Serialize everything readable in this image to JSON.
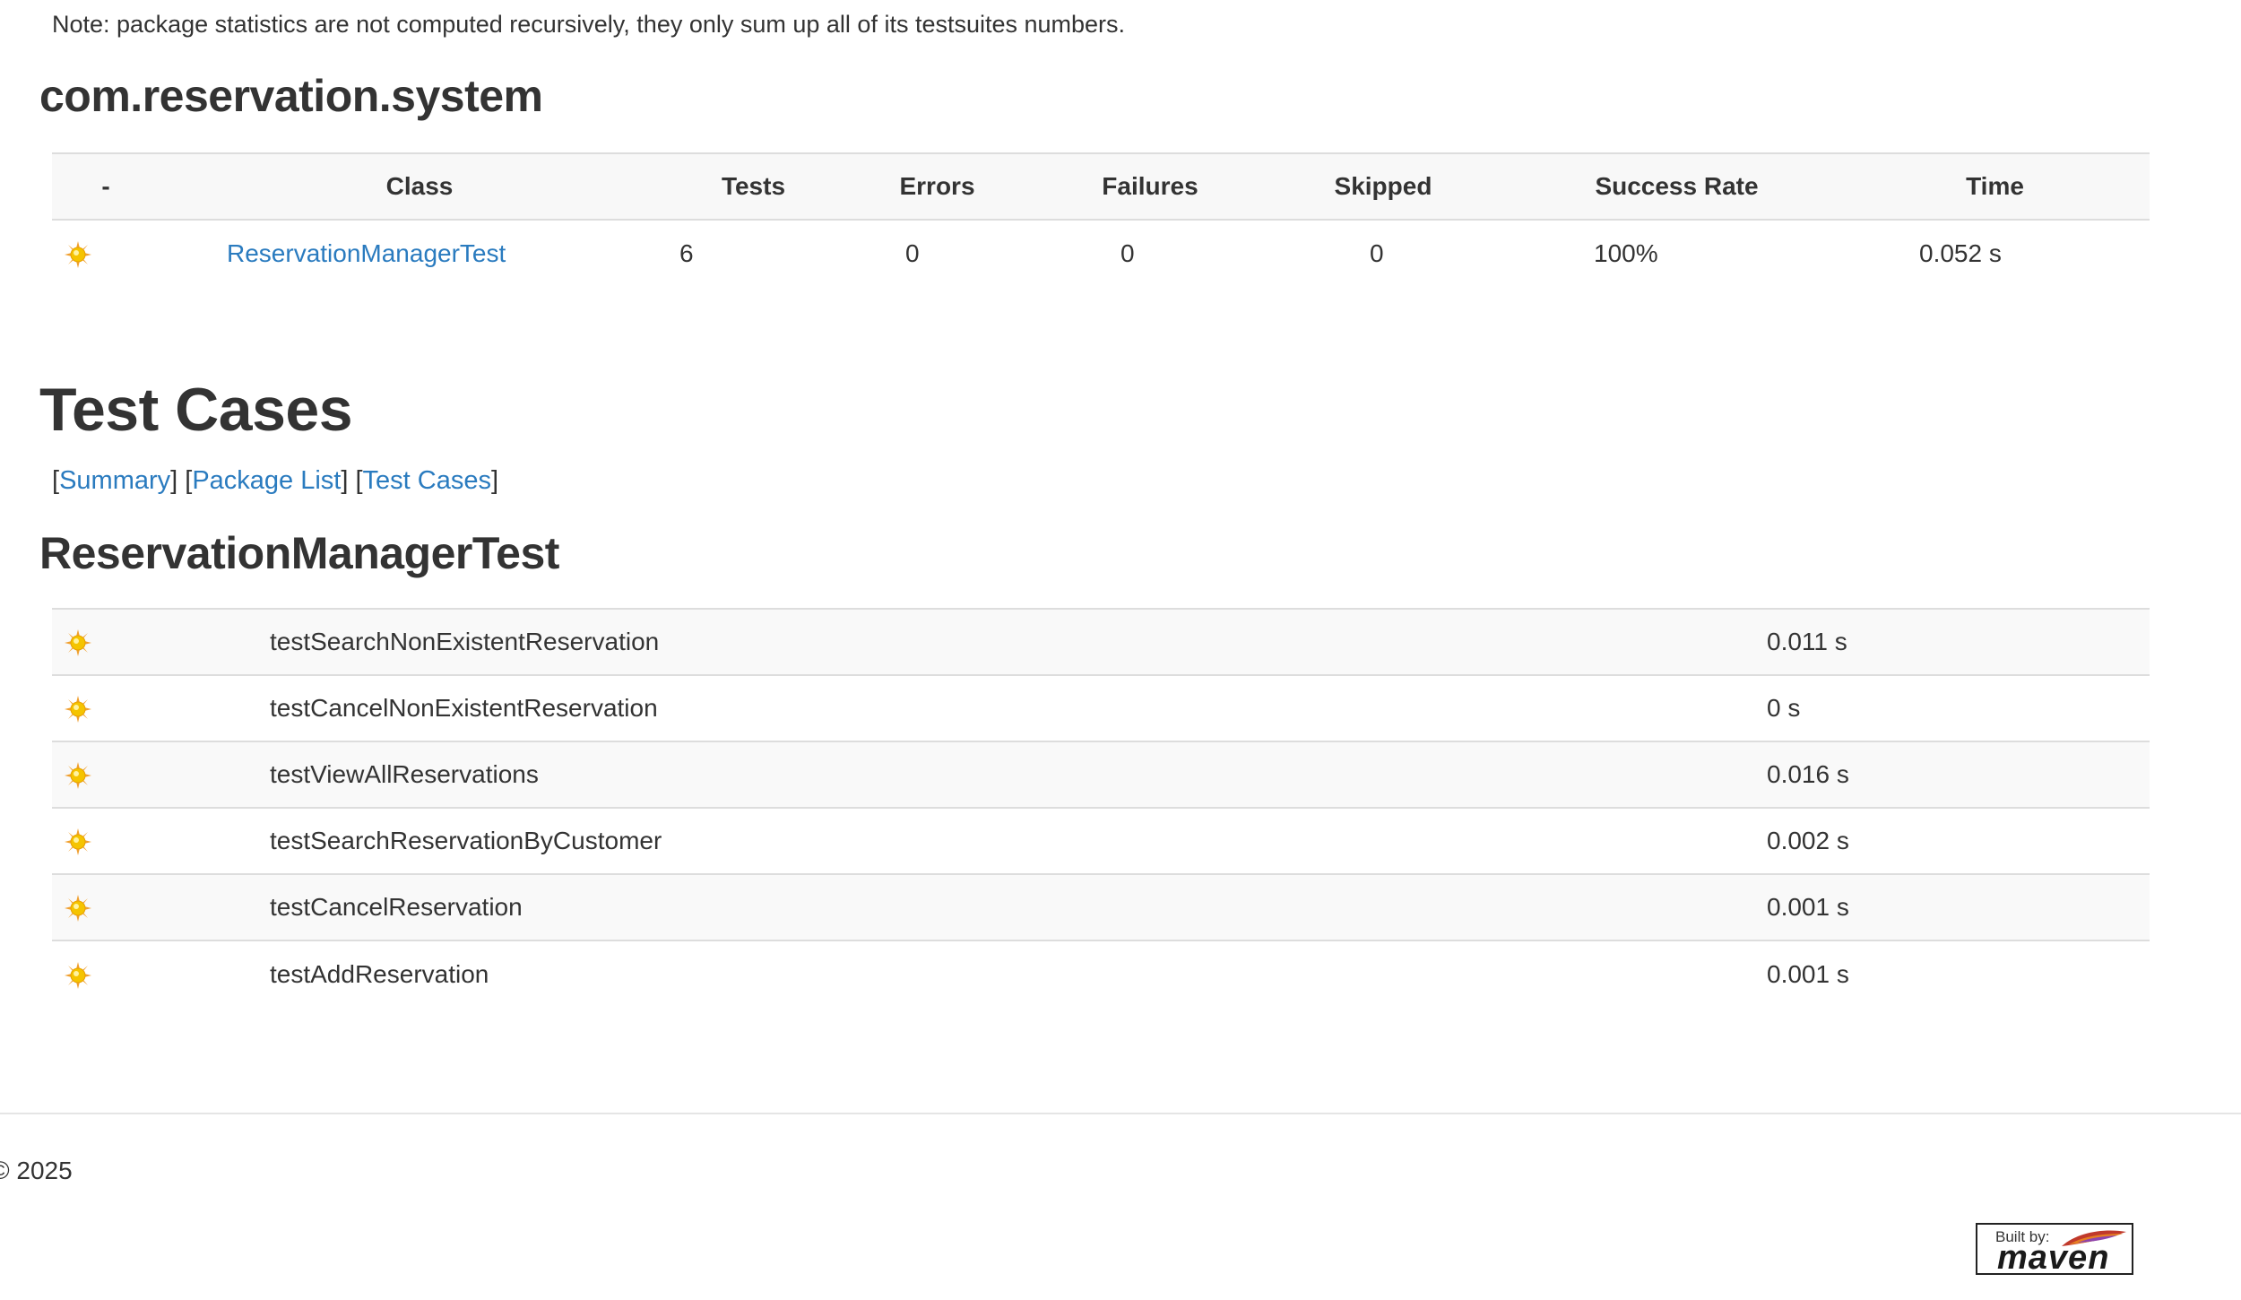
{
  "note": "Note: package statistics are not computed recursively, they only sum up all of its testsuites numbers.",
  "package": {
    "name": "com.reservation.system",
    "headers": [
      "-",
      "Class",
      "Tests",
      "Errors",
      "Failures",
      "Skipped",
      "Success Rate",
      "Time"
    ],
    "rows": [
      {
        "class": "ReservationManagerTest",
        "tests": "6",
        "errors": "0",
        "failures": "0",
        "skipped": "0",
        "success_rate": "100%",
        "time": "0.052 s"
      }
    ]
  },
  "test_cases": {
    "title": "Test Cases",
    "nav": {
      "summary": "Summary",
      "package_list": "Package List",
      "test_cases": "Test Cases"
    },
    "class_name": "ReservationManagerTest",
    "rows": [
      {
        "name": "testSearchNonExistentReservation",
        "time": "0.011 s"
      },
      {
        "name": "testCancelNonExistentReservation",
        "time": "0 s"
      },
      {
        "name": "testViewAllReservations",
        "time": "0.016 s"
      },
      {
        "name": "testSearchReservationByCustomer",
        "time": "0.002 s"
      },
      {
        "name": "testCancelReservation",
        "time": "0.001 s"
      },
      {
        "name": "testAddReservation",
        "time": "0.001 s"
      }
    ]
  },
  "footer": {
    "copyright": "© 2025",
    "badge_built": "Built by:",
    "badge_name": "maven"
  },
  "icons": {
    "status": "success-sun-icon",
    "badge": "maven-feather-icon"
  },
  "colors": {
    "link": "#2a7bbf",
    "icon_yellow": "#f5c400",
    "icon_orange": "#f0a030"
  }
}
